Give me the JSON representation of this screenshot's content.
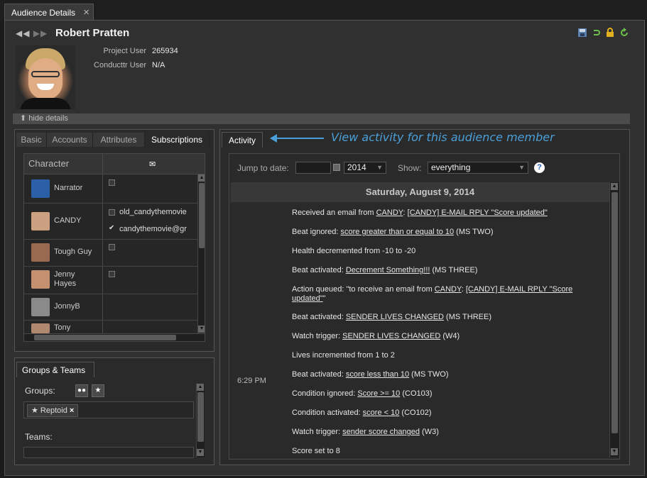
{
  "tab": {
    "title": "Audience Details",
    "close": "×"
  },
  "profile": {
    "name": "Robert Pratten",
    "nav_prev": "◀◀",
    "nav_next": "▶▶",
    "project_user_label": "Project User",
    "project_user_value": "265934",
    "conducttr_user_label": "Conducttr User",
    "conducttr_user_value": "N/A",
    "hide_details": "hide details"
  },
  "toolbar_icons": [
    "save-icon",
    "undo-icon",
    "lock-icon",
    "refresh-icon"
  ],
  "subtabs": [
    "Basic",
    "Accounts",
    "Attributes",
    "Subscriptions"
  ],
  "subscriptions": {
    "col_character": "Character",
    "col_email_icon": "✉",
    "rows": [
      {
        "name": "Narrator",
        "color": "#2b5fa8",
        "items": []
      },
      {
        "name": "CANDY",
        "color": "#caa080",
        "items": [
          "old_candythemovie",
          "candythemovie@gr"
        ]
      },
      {
        "name": "Tough Guy",
        "color": "#9a6a50",
        "items": []
      },
      {
        "name": "Jenny Hayes",
        "color": "#c49070",
        "items": []
      },
      {
        "name": "JonnyB",
        "color": "#8a8a8a",
        "items": []
      },
      {
        "name": "Tony",
        "color": "#b08870",
        "items": []
      }
    ]
  },
  "groups": {
    "tab_label": "Groups & Teams",
    "groups_label": "Groups:",
    "teams_label": "Teams:",
    "chip_label": "★ Reptoid",
    "chip_close": "×"
  },
  "activity": {
    "tab_label": "Activity",
    "annotation": "View activity for this audience member",
    "jump_label": "Jump to date:",
    "year": "2014",
    "show_label": "Show:",
    "show_value": "everything",
    "help": "?",
    "date_header": "Saturday, August 9, 2014",
    "time": "6:29 PM",
    "entries": [
      {
        "pre": "Received an email from ",
        "l1": "CANDY",
        "mid": ": ",
        "l2": "[CANDY] E-MAIL RPLY \"Score updated\"",
        "post": ""
      },
      {
        "pre": "Beat ignored: ",
        "l1": "score greater than or equal to 10",
        "mid": "",
        "l2": "",
        "post": " (MS TWO)"
      },
      {
        "pre": "Health decremented from -10 to -20",
        "l1": "",
        "mid": "",
        "l2": "",
        "post": ""
      },
      {
        "pre": "Beat activated: ",
        "l1": "Decrement Something!!!",
        "mid": "",
        "l2": "",
        "post": " (MS THREE)"
      },
      {
        "pre": "Action queued: \"to receive an email from ",
        "l1": "CANDY",
        "mid": ": ",
        "l2": "[CANDY] E-MAIL RPLY \"Score updated\"",
        "post": "\""
      },
      {
        "pre": "Beat activated: ",
        "l1": "SENDER LIVES CHANGED",
        "mid": "",
        "l2": "",
        "post": " (MS THREE)"
      },
      {
        "pre": "Watch trigger: ",
        "l1": "SENDER LIVES CHANGED",
        "mid": "",
        "l2": "",
        "post": " (W4)"
      },
      {
        "pre": "Lives incremented from 1 to 2",
        "l1": "",
        "mid": "",
        "l2": "",
        "post": ""
      },
      {
        "pre": "Beat activated: ",
        "l1": "score less than 10",
        "mid": "",
        "l2": "",
        "post": " (MS TWO)"
      },
      {
        "pre": "Condition ignored: ",
        "l1": "Score >= 10",
        "mid": "",
        "l2": "",
        "post": " (CO103)"
      },
      {
        "pre": "Condition activated: ",
        "l1": "score < 10",
        "mid": "",
        "l2": "",
        "post": " (CO102)"
      },
      {
        "pre": "Watch trigger: ",
        "l1": "sender score changed",
        "mid": "",
        "l2": "",
        "post": " (W3)"
      },
      {
        "pre": "Score set to 8",
        "l1": "",
        "mid": "",
        "l2": "",
        "post": ""
      }
    ]
  }
}
